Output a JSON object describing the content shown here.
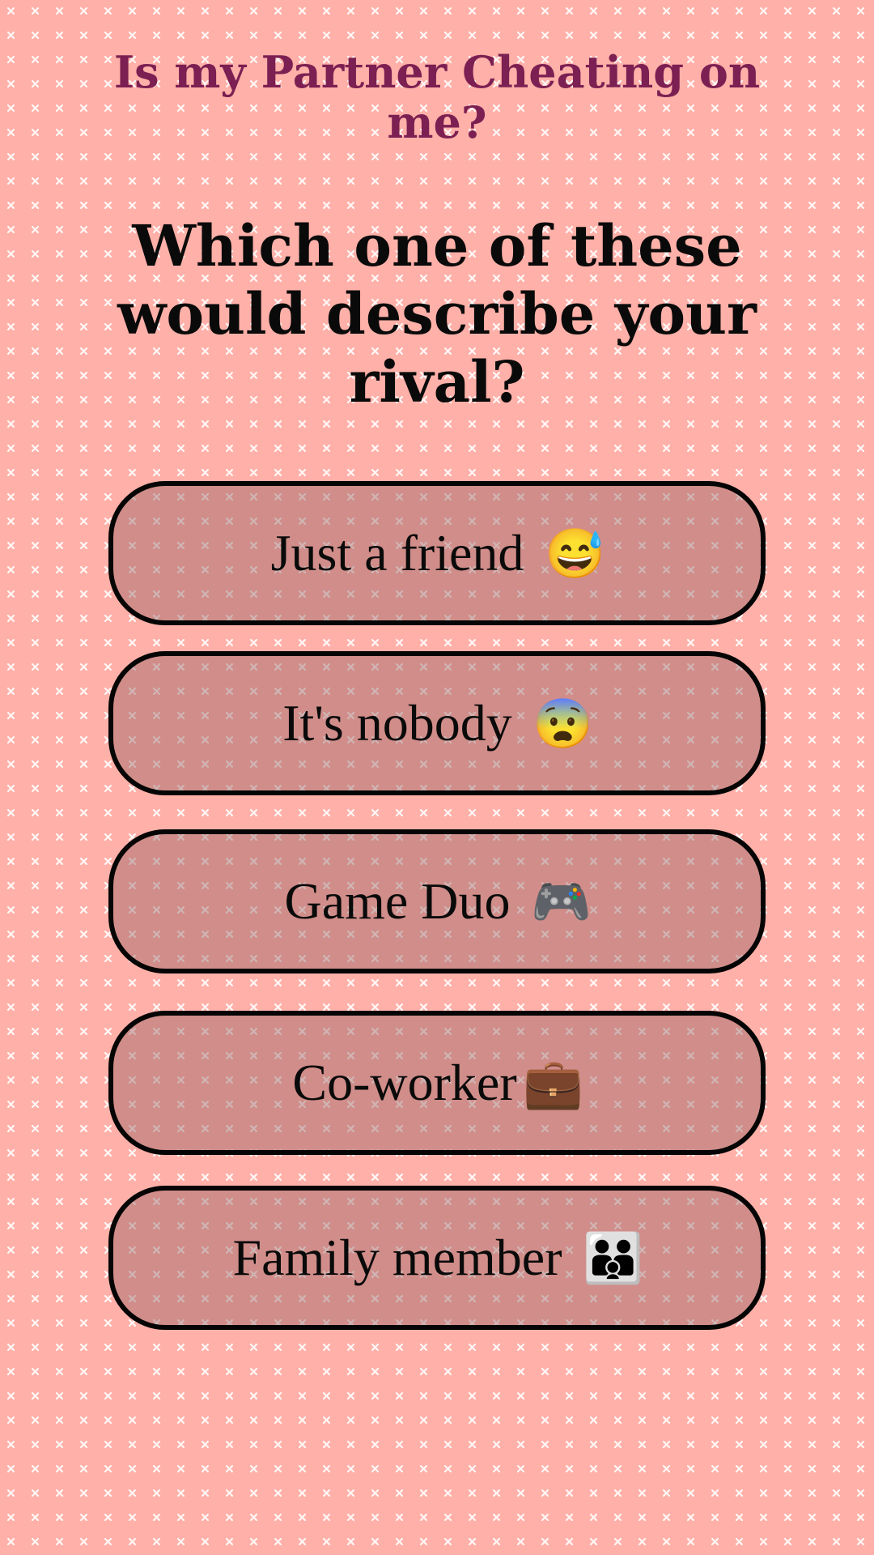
{
  "header": {
    "title": "Is my Partner Cheating on me?"
  },
  "question": {
    "text": "Which one of these would describe your rival?"
  },
  "options": [
    {
      "label": "Just a friend",
      "icon": "grinning-sweat-icon",
      "glyph": "😅"
    },
    {
      "label": "It's nobody",
      "icon": "fearful-face-icon",
      "glyph": "😨"
    },
    {
      "label": "Game Duo",
      "icon": "game-controller-icon",
      "glyph": "🎮"
    },
    {
      "label": "Co-worker",
      "icon": "briefcase-icon",
      "glyph": "💼"
    },
    {
      "label": "Family member",
      "icon": "family-icon",
      "glyph": "👪"
    }
  ],
  "colors": {
    "background": "#ffb0a8",
    "title": "#7c1f52",
    "button_fill": "#c08c89",
    "button_border": "#050505"
  }
}
